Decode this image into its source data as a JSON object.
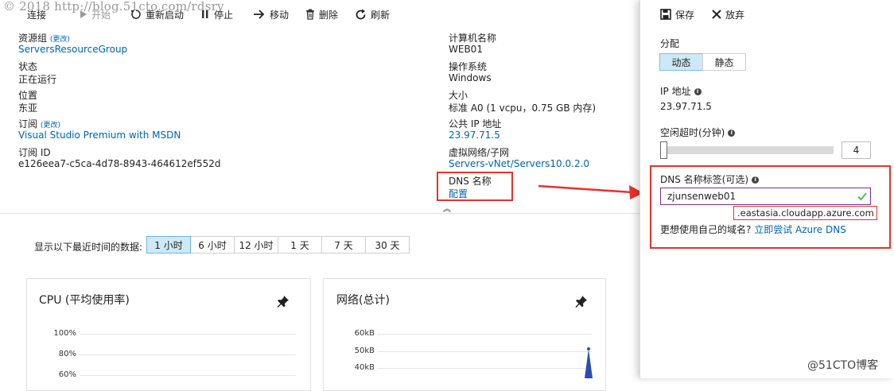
{
  "watermark_top": "© 2018 http://blog.51cto.com/rdsrv",
  "watermark_bottom": "@51CTO博客",
  "toolbar": {
    "connect": "连接",
    "start": "开始",
    "restart": "重新启动",
    "stop": "停止",
    "move": "移动",
    "delete": "删除",
    "refresh": "刷新"
  },
  "essentials": {
    "left": {
      "resource_group_label": "资源组",
      "change": "(更改)",
      "resource_group_value": "ServersResourceGroup",
      "status_label": "状态",
      "status_value": "正在运行",
      "location_label": "位置",
      "location_value": "东亚",
      "subscription_label": "订阅",
      "subscription_value": "Visual Studio Premium with MSDN",
      "subscription_id_label": "订阅 ID",
      "subscription_id_value": "e126eea7-c5ca-4d78-8943-464612ef552d"
    },
    "right": {
      "computer_name_label": "计算机名称",
      "computer_name_value": "WEB01",
      "os_label": "操作系统",
      "os_value": "Windows",
      "size_label": "大小",
      "size_value": "标准 A0 (1 vcpu，0.75 GB 内存)",
      "public_ip_label": "公共 IP 地址",
      "public_ip_value": "23.97.71.5",
      "vnet_label": "虚拟网络/子网",
      "vnet_value": "Servers-vNet/Servers10.0.2.0",
      "dns_label": "DNS 名称",
      "dns_value": "配置"
    },
    "collapse_glyph": "︽"
  },
  "time_range": {
    "label": "显示以下最近时间的数据:",
    "options": [
      "1 小时",
      "6 小时",
      "12 小时",
      "1 天",
      "7 天",
      "30 天"
    ],
    "selected_index": 0
  },
  "cards": {
    "cpu": {
      "title": "CPU (平均使用率)",
      "ticks": [
        "100%",
        "80%",
        "60%"
      ]
    },
    "network": {
      "title": "网络(总计)",
      "ticks": [
        "60kB",
        "50kB",
        "40kB"
      ]
    }
  },
  "blade": {
    "save": "保存",
    "discard": "放弃",
    "allocation_label": "分配",
    "allocation_options": [
      "动态",
      "静态"
    ],
    "allocation_selected": 0,
    "ip_label": "IP 地址",
    "ip_value": "23.97.71.5",
    "idle_timeout_label": "空闲超时(分钟)",
    "idle_timeout_value": "4",
    "idle_timeout_fraction": 0.0,
    "dns_label_title": "DNS 名称标签(可选)",
    "dns_input_value": "zjunsenweb01",
    "dns_suffix": ".eastasia.cloudapp.azure.com",
    "own_domain_text": "更想使用自己的域名?",
    "own_domain_link": "立即尝试 Azure DNS"
  },
  "colors": {
    "accent": "#0063b1",
    "highlight": "#e8312a",
    "selected_bg": "#cde9f7",
    "input_border": "#7a2d8c",
    "valid_check": "#5cb85c"
  }
}
